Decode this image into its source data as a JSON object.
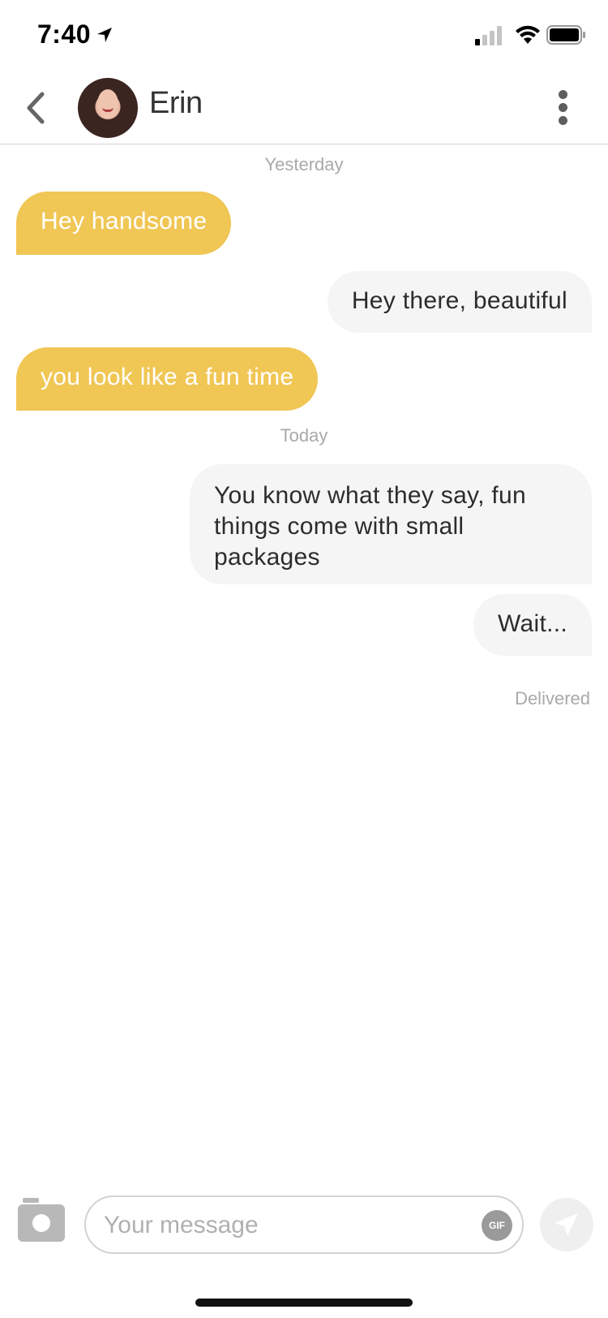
{
  "status_bar": {
    "time": "7:40"
  },
  "header": {
    "contact_name": "Erin"
  },
  "conversation": {
    "yesterday_label": "Yesterday",
    "today_label": "Today",
    "messages": [
      {
        "direction": "incoming",
        "text": "Hey handsome"
      },
      {
        "direction": "outgoing",
        "text": "Hey there, beautiful"
      },
      {
        "direction": "incoming",
        "text": "you look like a fun time"
      },
      {
        "direction": "outgoing",
        "text": "You know what they say, fun things come with small packages"
      },
      {
        "direction": "outgoing",
        "text": "Wait..."
      }
    ],
    "delivery_status": "Delivered"
  },
  "composer": {
    "placeholder": "Your message",
    "gif_label": "GIF"
  },
  "colors": {
    "incoming_bubble": "#f0c654",
    "outgoing_bubble": "#f5f5f5"
  }
}
